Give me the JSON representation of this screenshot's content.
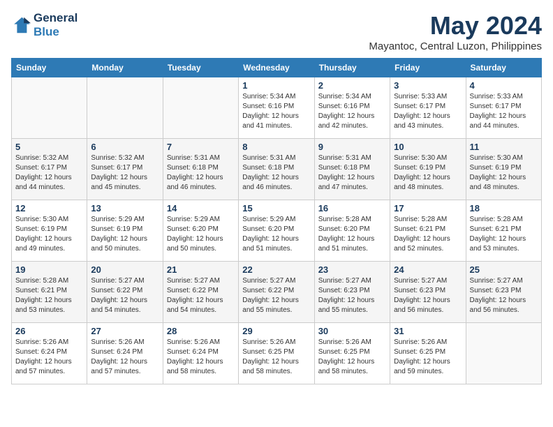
{
  "logo": {
    "line1": "General",
    "line2": "Blue"
  },
  "title": "May 2024",
  "subtitle": "Mayantoc, Central Luzon, Philippines",
  "headers": [
    "Sunday",
    "Monday",
    "Tuesday",
    "Wednesday",
    "Thursday",
    "Friday",
    "Saturday"
  ],
  "weeks": [
    [
      {
        "day": "",
        "info": ""
      },
      {
        "day": "",
        "info": ""
      },
      {
        "day": "",
        "info": ""
      },
      {
        "day": "1",
        "info": "Sunrise: 5:34 AM\nSunset: 6:16 PM\nDaylight: 12 hours\nand 41 minutes."
      },
      {
        "day": "2",
        "info": "Sunrise: 5:34 AM\nSunset: 6:16 PM\nDaylight: 12 hours\nand 42 minutes."
      },
      {
        "day": "3",
        "info": "Sunrise: 5:33 AM\nSunset: 6:17 PM\nDaylight: 12 hours\nand 43 minutes."
      },
      {
        "day": "4",
        "info": "Sunrise: 5:33 AM\nSunset: 6:17 PM\nDaylight: 12 hours\nand 44 minutes."
      }
    ],
    [
      {
        "day": "5",
        "info": "Sunrise: 5:32 AM\nSunset: 6:17 PM\nDaylight: 12 hours\nand 44 minutes."
      },
      {
        "day": "6",
        "info": "Sunrise: 5:32 AM\nSunset: 6:17 PM\nDaylight: 12 hours\nand 45 minutes."
      },
      {
        "day": "7",
        "info": "Sunrise: 5:31 AM\nSunset: 6:18 PM\nDaylight: 12 hours\nand 46 minutes."
      },
      {
        "day": "8",
        "info": "Sunrise: 5:31 AM\nSunset: 6:18 PM\nDaylight: 12 hours\nand 46 minutes."
      },
      {
        "day": "9",
        "info": "Sunrise: 5:31 AM\nSunset: 6:18 PM\nDaylight: 12 hours\nand 47 minutes."
      },
      {
        "day": "10",
        "info": "Sunrise: 5:30 AM\nSunset: 6:19 PM\nDaylight: 12 hours\nand 48 minutes."
      },
      {
        "day": "11",
        "info": "Sunrise: 5:30 AM\nSunset: 6:19 PM\nDaylight: 12 hours\nand 48 minutes."
      }
    ],
    [
      {
        "day": "12",
        "info": "Sunrise: 5:30 AM\nSunset: 6:19 PM\nDaylight: 12 hours\nand 49 minutes."
      },
      {
        "day": "13",
        "info": "Sunrise: 5:29 AM\nSunset: 6:19 PM\nDaylight: 12 hours\nand 50 minutes."
      },
      {
        "day": "14",
        "info": "Sunrise: 5:29 AM\nSunset: 6:20 PM\nDaylight: 12 hours\nand 50 minutes."
      },
      {
        "day": "15",
        "info": "Sunrise: 5:29 AM\nSunset: 6:20 PM\nDaylight: 12 hours\nand 51 minutes."
      },
      {
        "day": "16",
        "info": "Sunrise: 5:28 AM\nSunset: 6:20 PM\nDaylight: 12 hours\nand 51 minutes."
      },
      {
        "day": "17",
        "info": "Sunrise: 5:28 AM\nSunset: 6:21 PM\nDaylight: 12 hours\nand 52 minutes."
      },
      {
        "day": "18",
        "info": "Sunrise: 5:28 AM\nSunset: 6:21 PM\nDaylight: 12 hours\nand 53 minutes."
      }
    ],
    [
      {
        "day": "19",
        "info": "Sunrise: 5:28 AM\nSunset: 6:21 PM\nDaylight: 12 hours\nand 53 minutes."
      },
      {
        "day": "20",
        "info": "Sunrise: 5:27 AM\nSunset: 6:22 PM\nDaylight: 12 hours\nand 54 minutes."
      },
      {
        "day": "21",
        "info": "Sunrise: 5:27 AM\nSunset: 6:22 PM\nDaylight: 12 hours\nand 54 minutes."
      },
      {
        "day": "22",
        "info": "Sunrise: 5:27 AM\nSunset: 6:22 PM\nDaylight: 12 hours\nand 55 minutes."
      },
      {
        "day": "23",
        "info": "Sunrise: 5:27 AM\nSunset: 6:23 PM\nDaylight: 12 hours\nand 55 minutes."
      },
      {
        "day": "24",
        "info": "Sunrise: 5:27 AM\nSunset: 6:23 PM\nDaylight: 12 hours\nand 56 minutes."
      },
      {
        "day": "25",
        "info": "Sunrise: 5:27 AM\nSunset: 6:23 PM\nDaylight: 12 hours\nand 56 minutes."
      }
    ],
    [
      {
        "day": "26",
        "info": "Sunrise: 5:26 AM\nSunset: 6:24 PM\nDaylight: 12 hours\nand 57 minutes."
      },
      {
        "day": "27",
        "info": "Sunrise: 5:26 AM\nSunset: 6:24 PM\nDaylight: 12 hours\nand 57 minutes."
      },
      {
        "day": "28",
        "info": "Sunrise: 5:26 AM\nSunset: 6:24 PM\nDaylight: 12 hours\nand 58 minutes."
      },
      {
        "day": "29",
        "info": "Sunrise: 5:26 AM\nSunset: 6:25 PM\nDaylight: 12 hours\nand 58 minutes."
      },
      {
        "day": "30",
        "info": "Sunrise: 5:26 AM\nSunset: 6:25 PM\nDaylight: 12 hours\nand 58 minutes."
      },
      {
        "day": "31",
        "info": "Sunrise: 5:26 AM\nSunset: 6:25 PM\nDaylight: 12 hours\nand 59 minutes."
      },
      {
        "day": "",
        "info": ""
      }
    ]
  ]
}
